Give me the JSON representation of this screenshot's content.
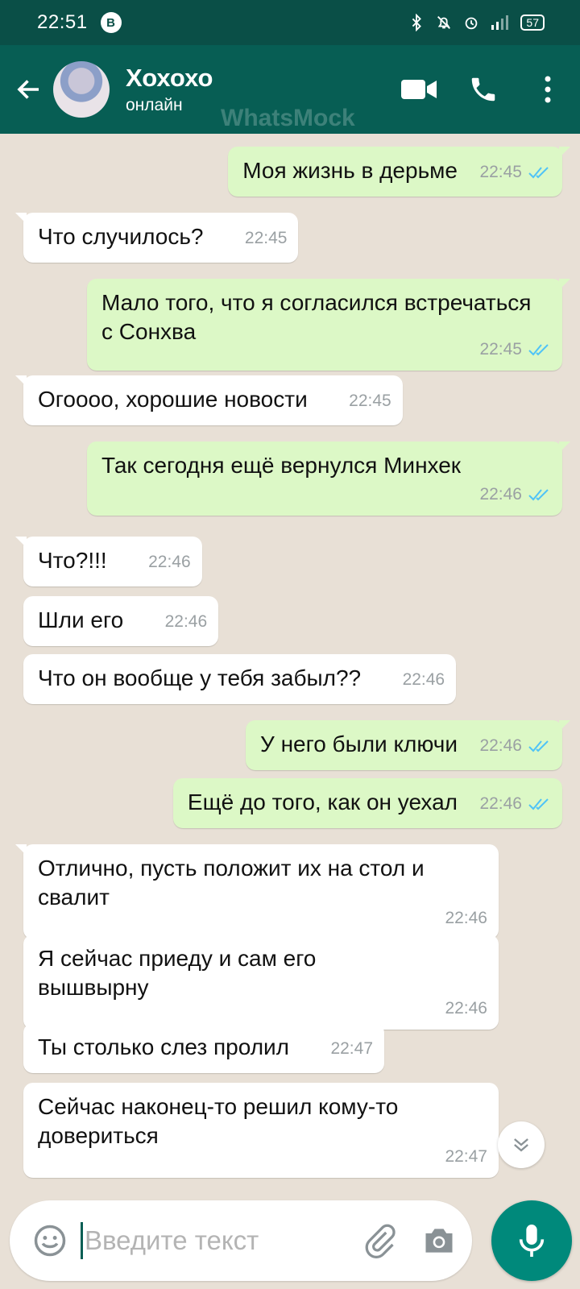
{
  "status_bar": {
    "time": "22:51",
    "badge": "B",
    "battery": "57"
  },
  "header": {
    "contact_name": "Хохохо",
    "contact_status": "онлайн",
    "watermark": "WhatsMock"
  },
  "messages": [
    {
      "dir": "out",
      "text": "Моя жизнь в дерьме",
      "time": "22:45",
      "read": true
    },
    {
      "dir": "in",
      "text": "Что случилось?",
      "time": "22:45"
    },
    {
      "dir": "out",
      "text": "Мало того, что я согласился встречаться с Сонхва",
      "time": "22:45",
      "read": true
    },
    {
      "dir": "in",
      "text": "Огоооо, хорошие новости",
      "time": "22:45"
    },
    {
      "dir": "out",
      "text": "Так сегодня ещё вернулся Минхек",
      "time": "22:46",
      "read": true
    },
    {
      "dir": "in",
      "text": "Что?!!!",
      "time": "22:46"
    },
    {
      "dir": "in",
      "text": "Шли его",
      "time": "22:46"
    },
    {
      "dir": "in",
      "text": "Что он вообще у тебя забыл??",
      "time": "22:46"
    },
    {
      "dir": "out",
      "text": "У него были ключи",
      "time": "22:46",
      "read": true
    },
    {
      "dir": "out",
      "text": "Ещё до того, как он уехал",
      "time": "22:46",
      "read": true
    },
    {
      "dir": "in",
      "text": "Отлично, пусть положит их на стол и свалит",
      "time": "22:46"
    },
    {
      "dir": "in",
      "text": "Я сейчас приеду и сам его вышвырну",
      "time": "22:46"
    },
    {
      "dir": "in",
      "text": "Ты столько слез пролил",
      "time": "22:47"
    },
    {
      "dir": "in",
      "text": "Сейчас наконец-то решил кому-то довериться",
      "time": "22:47"
    }
  ],
  "input": {
    "placeholder": "Введите текст"
  },
  "colors": {
    "header": "#075e54",
    "status_bar": "#0a4f47",
    "outgoing": "#dcf8c6",
    "incoming": "#ffffff",
    "tick": "#4fc3f7",
    "mic": "#00897b"
  },
  "icons": [
    "back-arrow-icon",
    "video-call-icon",
    "phone-icon",
    "more-vert-icon",
    "chevron-down-icon",
    "emoji-icon",
    "attach-icon",
    "camera-icon",
    "mic-icon",
    "double-check-icon"
  ]
}
